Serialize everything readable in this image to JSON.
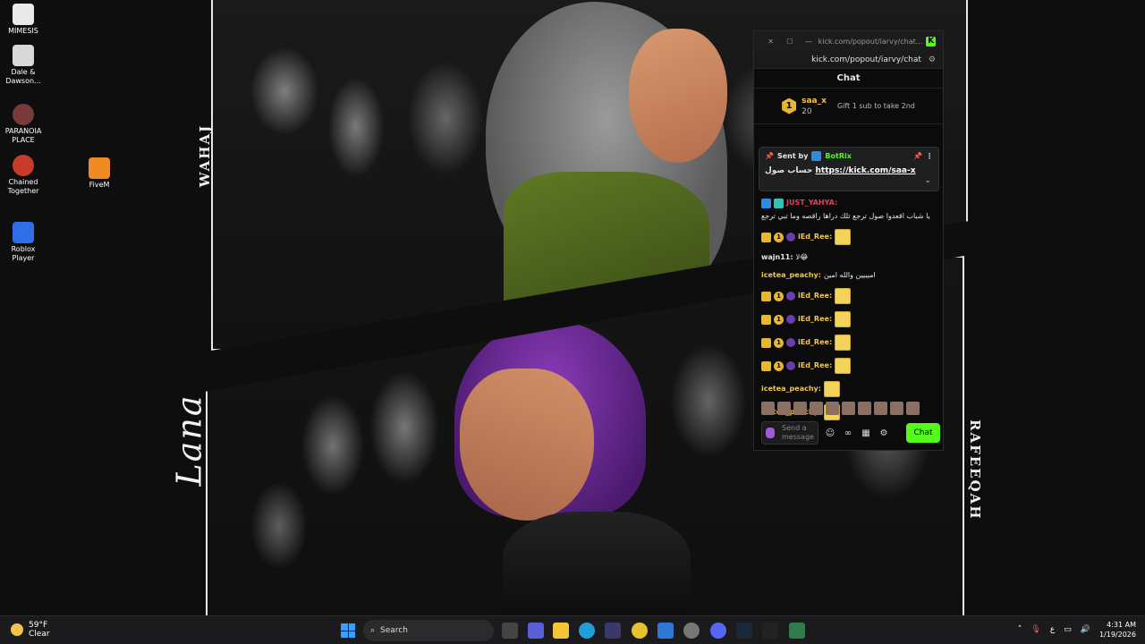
{
  "desktop": {
    "icons": [
      {
        "label": "MIMESIS"
      },
      {
        "label": "Dale & Dawson..."
      },
      {
        "label": "PARANOIA PLACE"
      },
      {
        "label": "Chained Together"
      },
      {
        "label": "FiveM"
      },
      {
        "label": "Roblox Player"
      }
    ],
    "wallpaper": {
      "label_top": "WAHAJ",
      "label_right": "RAFEEQAH",
      "label_script": "Lana"
    }
  },
  "chat_window": {
    "titlebar_url": "kick.com/popout/iarvy/chat...",
    "address": "kick.com/popout/iarvy/chat",
    "header": "Chat",
    "top_gifter": {
      "rank": "1",
      "name": "saa_x",
      "count": "20",
      "cta": "Gift 1 sub to take 2nd"
    },
    "pinned": {
      "sent_by_label": "Sent by",
      "sender": "BotRix",
      "message_prefix": "حساب صول",
      "link": "https://kick.com/saa-x"
    },
    "messages": [
      {
        "user": "JUST_YAHYA:",
        "text": "يا شباب اقعدوا صول ترجع تلك دراها راقصه وما تبي ترجع",
        "color": "#e0435a"
      },
      {
        "user": "iEd_Ree:",
        "text": "",
        "color": "#f0c64f"
      },
      {
        "user": "wajn11:",
        "text": "لا😂",
        "color": "#e6e6e6"
      },
      {
        "user": "icetea_peachy:",
        "text": "اميييين والله امين",
        "color": "#f0c64f"
      },
      {
        "user": "iEd_Ree:",
        "text": "",
        "color": "#f0c64f"
      },
      {
        "user": "iEd_Ree:",
        "text": "",
        "color": "#f0c64f"
      },
      {
        "user": "iEd_Ree:",
        "text": "",
        "color": "#f0c64f"
      },
      {
        "user": "iEd_Ree:",
        "text": "",
        "color": "#f0c64f"
      },
      {
        "user": "icetea_peachy:",
        "text": "",
        "color": "#f0c64f"
      },
      {
        "user": "icetea_peachy:",
        "text": "",
        "color": "#f0c64f"
      }
    ],
    "input_placeholder": "Send a message",
    "chat_button": "Chat",
    "accent": "#53fc18"
  },
  "taskbar": {
    "weather_temp": "59°F",
    "weather_desc": "Clear",
    "search_label": "Search",
    "tray_lang": "ع",
    "time": "4:31 AM",
    "date": "1/19/2026"
  }
}
